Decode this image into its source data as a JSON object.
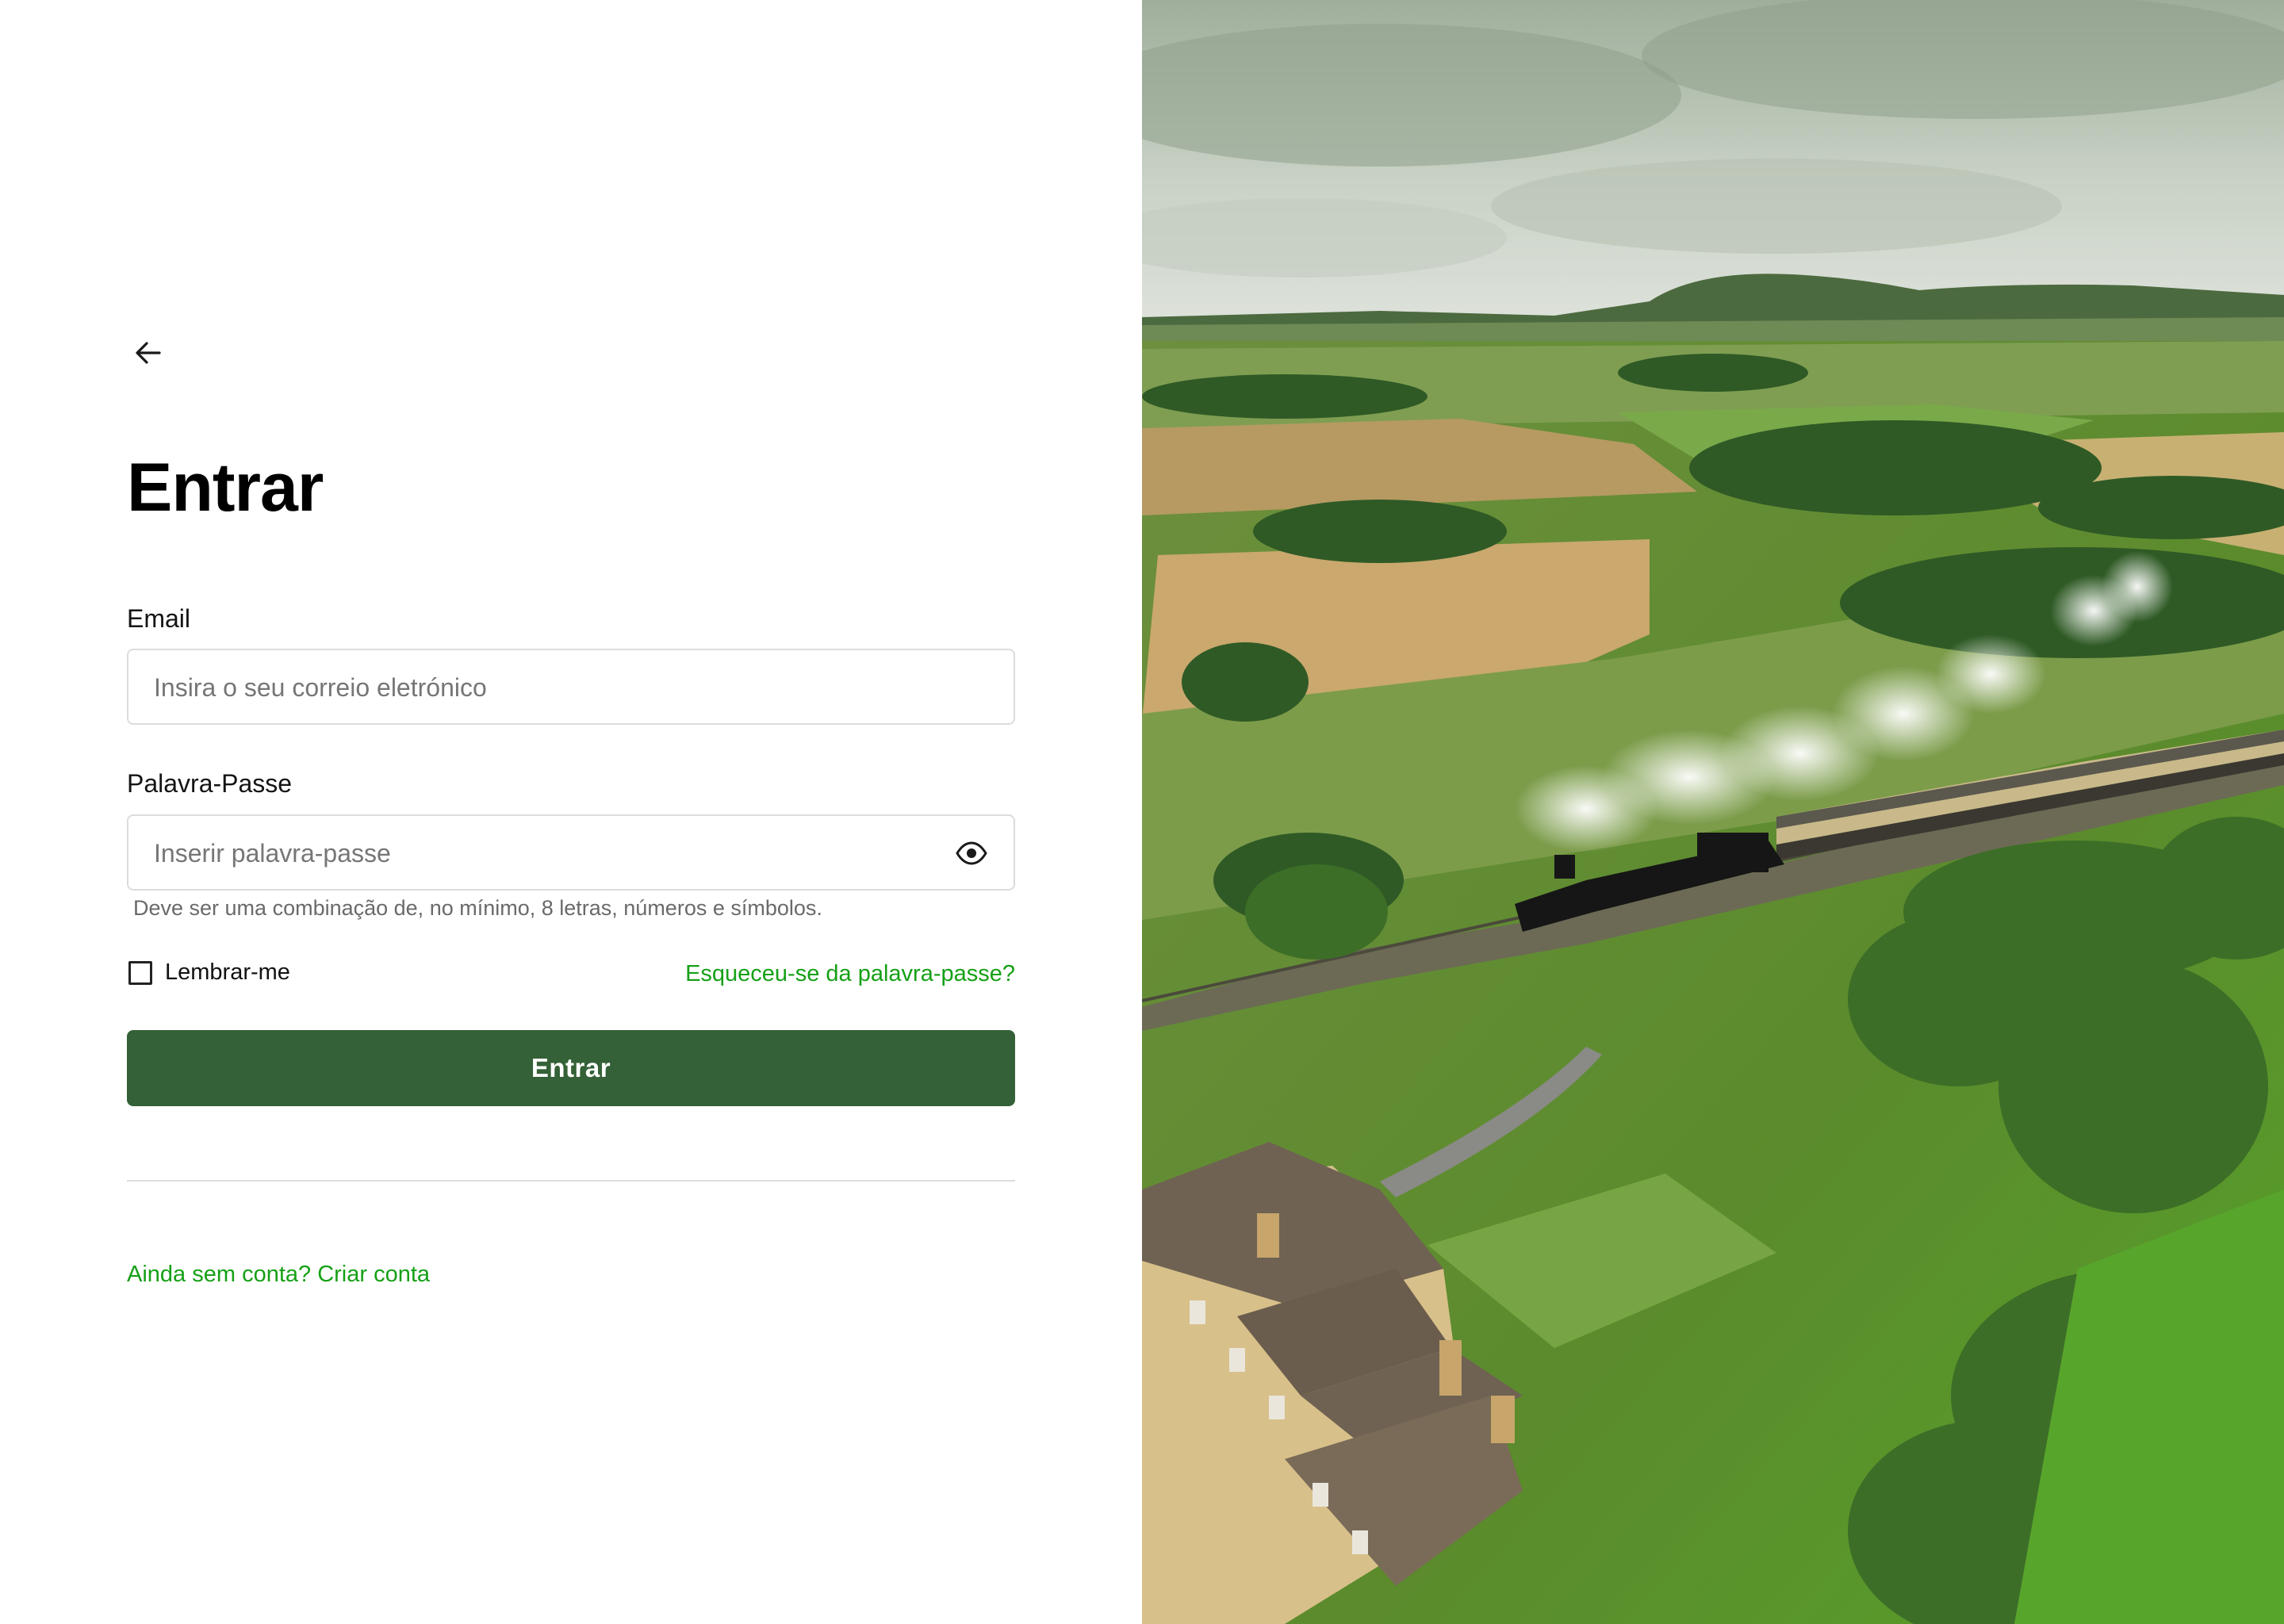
{
  "login": {
    "back_icon": "arrow-left-icon",
    "title": "Entrar",
    "email": {
      "label": "Email",
      "placeholder": "Insira o seu correio eletrónico",
      "value": ""
    },
    "password": {
      "label": "Palavra-Passe",
      "placeholder": "Inserir palavra-passe",
      "value": "",
      "toggle_icon": "eye-icon",
      "hint": "Deve ser uma combinação de, no mínimo, 8 letras, números e símbolos."
    },
    "remember_label": "Lembrar-me",
    "remember_checked": false,
    "forgot_link": "Esqueceu-se da palavra-passe?",
    "submit_label": "Entrar",
    "signup_link": "Ainda sem conta? Criar conta"
  },
  "colors": {
    "primary_button": "#346137",
    "link": "#16a016",
    "input_border": "#dcdcdc"
  }
}
